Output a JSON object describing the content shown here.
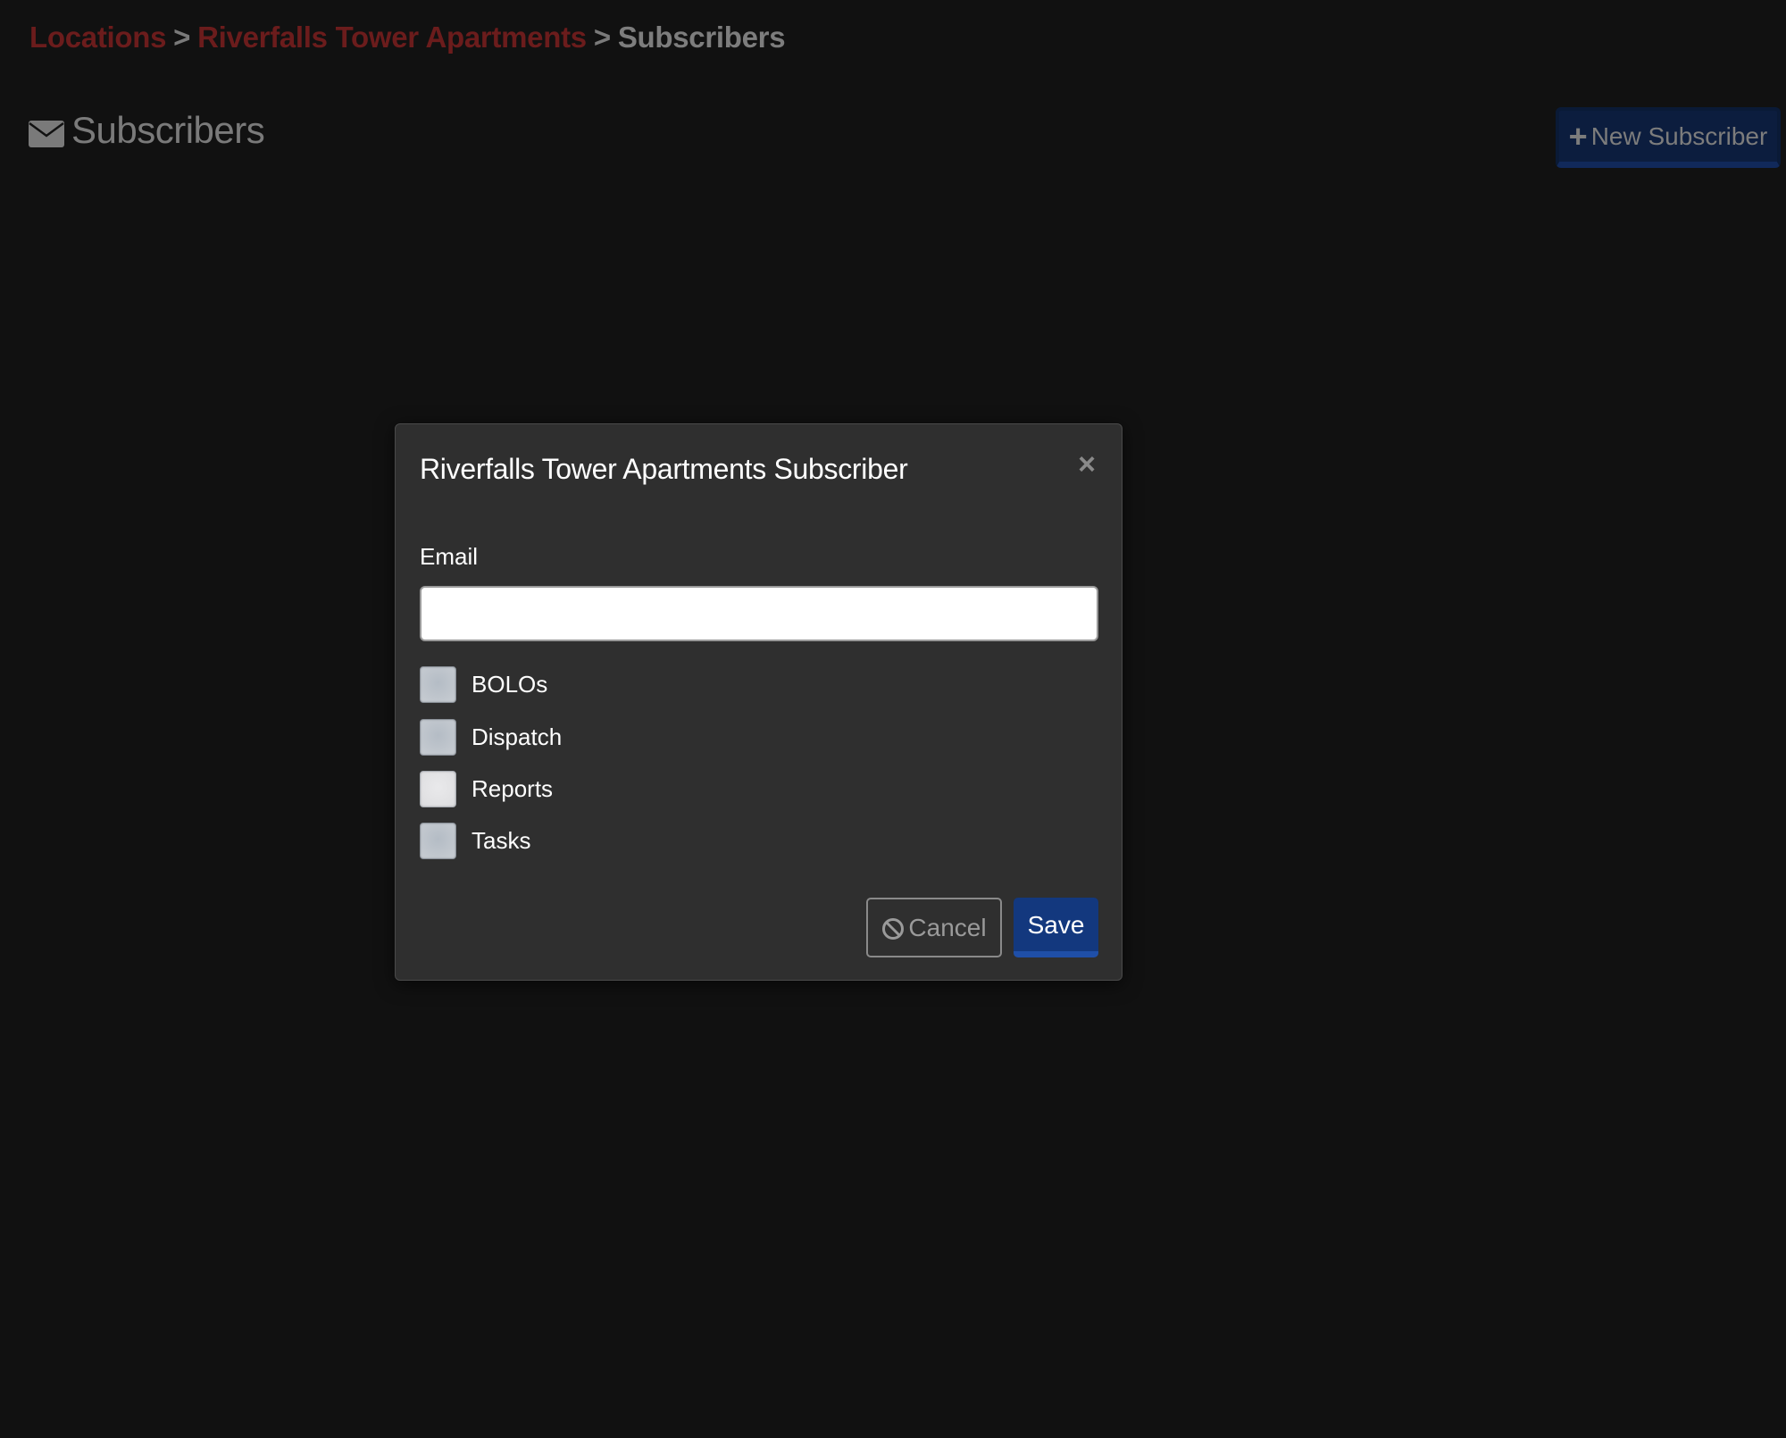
{
  "breadcrumb": {
    "items": [
      {
        "label": "Locations",
        "link": true
      },
      {
        "label": "Riverfalls Tower Apartments",
        "link": true
      },
      {
        "label": "Subscribers",
        "link": false
      }
    ],
    "separator": ">"
  },
  "header": {
    "icon": "envelope-icon",
    "title": "Subscribers",
    "new_button": {
      "icon": "plus-icon",
      "label": "New Subscriber"
    }
  },
  "modal": {
    "title": "Riverfalls Tower Apartments Subscriber",
    "close_icon": "close-icon",
    "close_glyph": "×",
    "email": {
      "label": "Email",
      "value": "",
      "placeholder": ""
    },
    "checkboxes": [
      {
        "label": "BOLOs",
        "checked": false
      },
      {
        "label": "Dispatch",
        "checked": false
      },
      {
        "label": "Reports",
        "checked": false
      },
      {
        "label": "Tasks",
        "checked": false
      }
    ],
    "cancel": {
      "icon": "ban-icon",
      "label": "Cancel"
    },
    "save": {
      "label": "Save"
    }
  },
  "colors": {
    "page_background": "#111111",
    "modal_background": "#2f2f2f",
    "breadcrumb_link": "#6b1c1c",
    "primary_button": "#13387e",
    "primary_button_accent": "#1f4fa8"
  }
}
